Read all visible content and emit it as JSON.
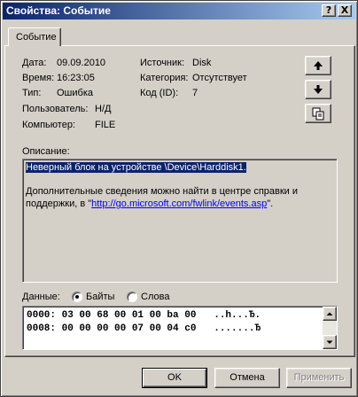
{
  "window": {
    "title": "Свойства: Событие"
  },
  "caption_buttons": {
    "help": "?",
    "close": "X"
  },
  "tab": {
    "label": "Событие"
  },
  "fields": {
    "date_label": "Дата:",
    "date_value": "09.09.2010",
    "time_label": "Время:",
    "time_value": "16:23:05",
    "type_label": "Тип:",
    "type_value": "Ошибка",
    "user_label": "Пользователь:",
    "user_value": "Н/Д",
    "computer_label": "Компьютер:",
    "computer_value": "FILE",
    "source_label": "Источник:",
    "source_value": "Disk",
    "category_label": "Категория:",
    "category_value": "Отсутствует",
    "code_label": "Код (ID):",
    "code_value": "7"
  },
  "side_buttons": {
    "up": "arrow-up-icon",
    "down": "arrow-down-icon",
    "copy": "copy-icon"
  },
  "description": {
    "label": "Описание:",
    "line1": "Неверный блок на устройстве \\Device\\Harddisk1.",
    "line2": "Дополнительные сведения можно найти в центре справки и",
    "line3_prefix": "поддержки, в \"",
    "link": "http://go.microsoft.com/fwlink/events.asp",
    "line3_suffix": "\"."
  },
  "data_section": {
    "label": "Данные:",
    "radio_bytes": "Байты",
    "radio_words": "Слова",
    "selected": "Байты",
    "rows": [
      "0000: 03 00 68 00 01 00 ba 00   ..h...Ђ.",
      "0008: 00 00 00 00 07 00 04 c0   .......Ђ"
    ]
  },
  "buttons": {
    "ok": "OK",
    "cancel": "Отмена",
    "apply": "Применить"
  }
}
